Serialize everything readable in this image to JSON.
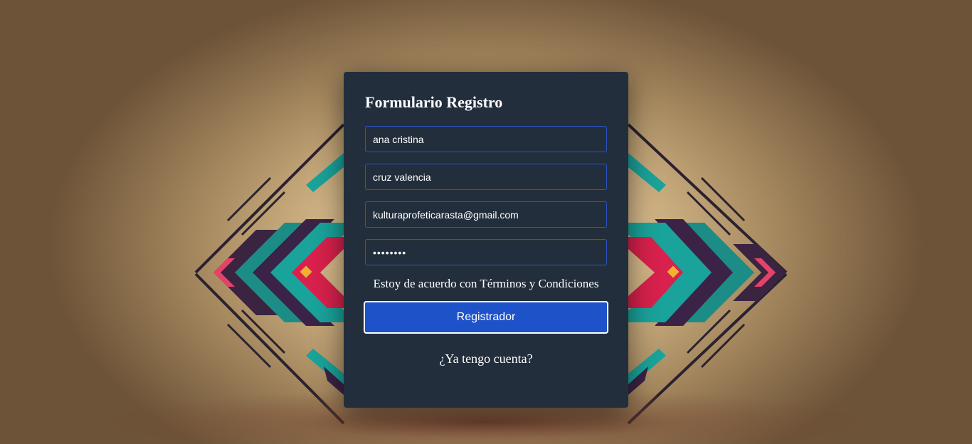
{
  "form": {
    "title": "Formulario Registro",
    "first_name_value": "ana cristina",
    "last_name_value": "cruz valencia",
    "email_value": "kulturaprofeticarasta@gmail.com",
    "password_value": "••••••••",
    "terms_text": "Estoy de acuerdo con Términos y Condiciones",
    "submit_label": "Registrador",
    "login_link": "¿Ya tengo cuenta?"
  },
  "colors": {
    "card_background": "#232e3c",
    "field_border": "#2b55c7",
    "button_background": "#1e52c9",
    "text": "#ffffff"
  }
}
